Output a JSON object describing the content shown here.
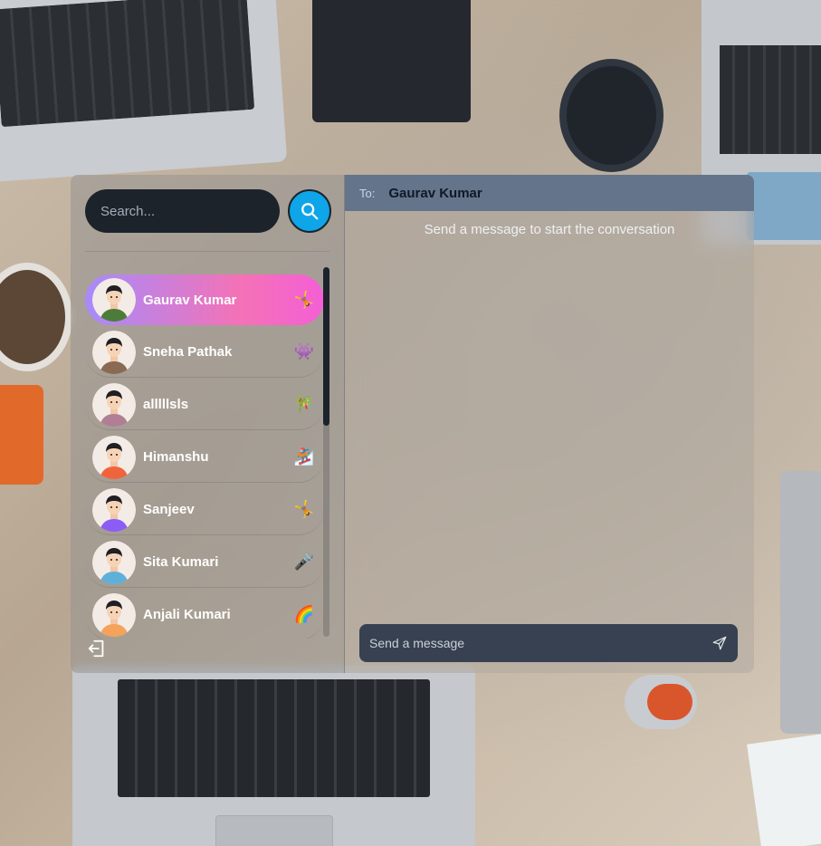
{
  "search": {
    "placeholder": "Search..."
  },
  "conversations": [
    {
      "name": "Gaurav Kumar",
      "emoji": "🤸",
      "active": true,
      "avatar_color": "#4d7c3a"
    },
    {
      "name": "Sneha Pathak",
      "emoji": "👾",
      "active": false,
      "avatar_color": "#8a6a52"
    },
    {
      "name": "alllllsls",
      "emoji": "🎋",
      "active": false,
      "avatar_color": "#b07f95"
    },
    {
      "name": "Himanshu",
      "emoji": "🏂",
      "active": false,
      "avatar_color": "#f0643c"
    },
    {
      "name": "Sanjeev",
      "emoji": "🤸",
      "active": false,
      "avatar_color": "#8b5cf6"
    },
    {
      "name": "Sita Kumari",
      "emoji": "🎤",
      "active": false,
      "avatar_color": "#5fb0d8"
    },
    {
      "name": "Anjali Kumari",
      "emoji": "🌈",
      "active": false,
      "avatar_color": "#f5a25a"
    }
  ],
  "chat": {
    "to_label": "To:",
    "recipient": "Gaurav Kumar",
    "empty_message": "Send a message to start the conversation",
    "composer_placeholder": "Send a message"
  },
  "colors": {
    "accent": "#0ea5e9",
    "active_gradient_start": "#a78bfa",
    "active_gradient_end": "#f472b6",
    "header": "#64748b",
    "composer": "#374151"
  },
  "icons": {
    "search": "search-icon",
    "logout": "logout-icon",
    "send": "send-icon"
  }
}
